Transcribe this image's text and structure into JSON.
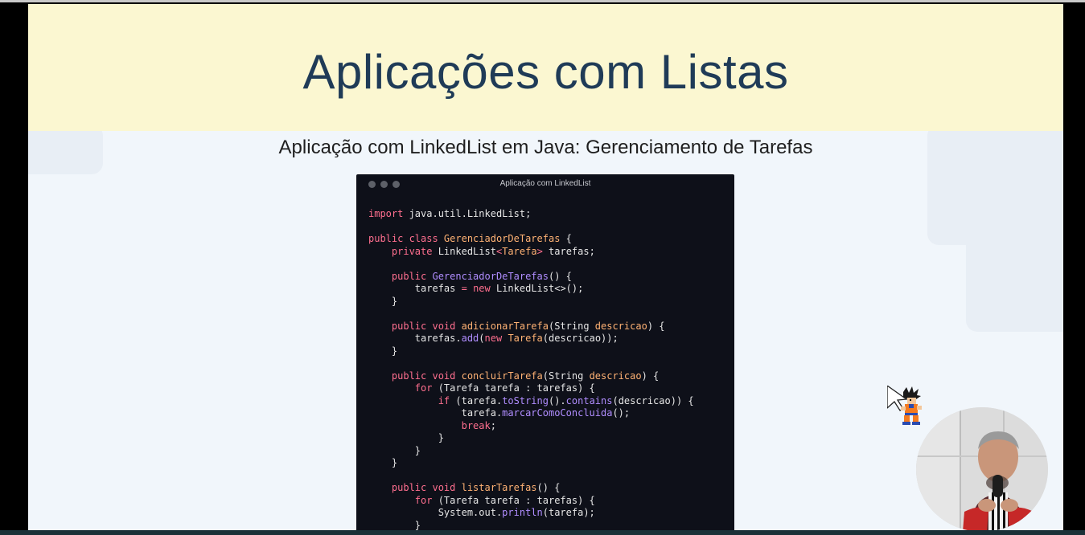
{
  "slide": {
    "title": "Aplicações com Listas",
    "subtitle": "Aplicação com LinkedList em Java: Gerenciamento de Tarefas"
  },
  "code_window": {
    "title": "Aplicação com LinkedList",
    "lines": [
      [
        [
          "kw",
          "import"
        ],
        [
          "pl",
          " java.util.LinkedList;"
        ]
      ],
      [],
      [
        [
          "kw",
          "public class "
        ],
        [
          "cl",
          "GerenciadorDeTarefas"
        ],
        [
          "pl",
          " {"
        ]
      ],
      [
        [
          "pl",
          "    "
        ],
        [
          "kw",
          "private"
        ],
        [
          "pl",
          " LinkedList"
        ],
        [
          "kw",
          "<"
        ],
        [
          "cl",
          "Tarefa"
        ],
        [
          "kw",
          ">"
        ],
        [
          "pl",
          " tarefas;"
        ]
      ],
      [],
      [
        [
          "pl",
          "    "
        ],
        [
          "kw",
          "public "
        ],
        [
          "fn",
          "GerenciadorDeTarefas"
        ],
        [
          "pl",
          "() {"
        ]
      ],
      [
        [
          "pl",
          "        tarefas "
        ],
        [
          "kw",
          "="
        ],
        [
          "pl",
          " "
        ],
        [
          "kw",
          "new"
        ],
        [
          "pl",
          " LinkedList<>();"
        ]
      ],
      [
        [
          "pl",
          "    }"
        ]
      ],
      [],
      [
        [
          "pl",
          "    "
        ],
        [
          "kw",
          "public void "
        ],
        [
          "cl",
          "adicionarTarefa"
        ],
        [
          "pl",
          "(String "
        ],
        [
          "cl",
          "descricao"
        ],
        [
          "pl",
          ") {"
        ]
      ],
      [
        [
          "pl",
          "        tarefas."
        ],
        [
          "fn",
          "add"
        ],
        [
          "pl",
          "("
        ],
        [
          "kw",
          "new"
        ],
        [
          "pl",
          " "
        ],
        [
          "cl",
          "Tarefa"
        ],
        [
          "pl",
          "(descricao));"
        ]
      ],
      [
        [
          "pl",
          "    }"
        ]
      ],
      [],
      [
        [
          "pl",
          "    "
        ],
        [
          "kw",
          "public void "
        ],
        [
          "cl",
          "concluirTarefa"
        ],
        [
          "pl",
          "(String "
        ],
        [
          "cl",
          "descricao"
        ],
        [
          "pl",
          ") {"
        ]
      ],
      [
        [
          "pl",
          "        "
        ],
        [
          "kw",
          "for"
        ],
        [
          "pl",
          " (Tarefa tarefa : tarefas) {"
        ]
      ],
      [
        [
          "pl",
          "            "
        ],
        [
          "kw",
          "if"
        ],
        [
          "pl",
          " (tarefa."
        ],
        [
          "fn",
          "toString"
        ],
        [
          "pl",
          "()."
        ],
        [
          "fn",
          "contains"
        ],
        [
          "pl",
          "(descricao)) {"
        ]
      ],
      [
        [
          "pl",
          "                tarefa."
        ],
        [
          "fn",
          "marcarComoConcluida"
        ],
        [
          "pl",
          "();"
        ]
      ],
      [
        [
          "pl",
          "                "
        ],
        [
          "kw",
          "break"
        ],
        [
          "pl",
          ";"
        ]
      ],
      [
        [
          "pl",
          "            }"
        ]
      ],
      [
        [
          "pl",
          "        }"
        ]
      ],
      [
        [
          "pl",
          "    }"
        ]
      ],
      [],
      [
        [
          "pl",
          "    "
        ],
        [
          "kw",
          "public void "
        ],
        [
          "cl",
          "listarTarefas"
        ],
        [
          "pl",
          "() {"
        ]
      ],
      [
        [
          "pl",
          "        "
        ],
        [
          "kw",
          "for"
        ],
        [
          "pl",
          " (Tarefa tarefa : tarefas) {"
        ]
      ],
      [
        [
          "pl",
          "            System.out."
        ],
        [
          "fn",
          "println"
        ],
        [
          "pl",
          "(tarefa);"
        ]
      ],
      [
        [
          "pl",
          "        }"
        ]
      ]
    ]
  },
  "colors": {
    "title_band": "#fbf7d1",
    "title_text": "#1f3b57",
    "slide_background": "#f1f6fb",
    "code_background": "#0e1019",
    "keyword": "#ff6f8f",
    "class_name": "#ffb274",
    "method": "#b08dff"
  },
  "icons": {
    "sprite": "goku-sprite-icon",
    "webcam": "presenter-webcam"
  }
}
